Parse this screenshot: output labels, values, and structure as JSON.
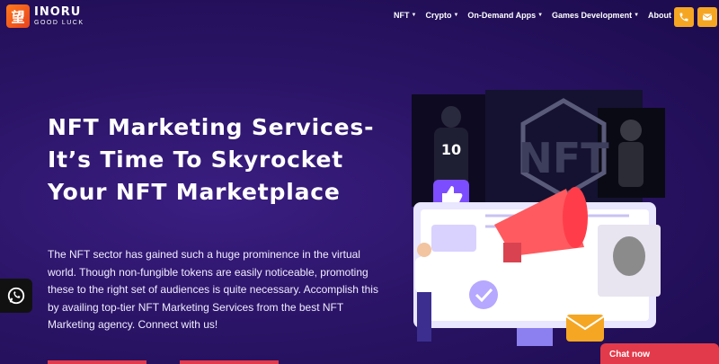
{
  "brand": {
    "logo_mark": "望",
    "name": "INORU",
    "tagline": "GOOD LUCK"
  },
  "nav": {
    "items": [
      {
        "label": "NFT",
        "has_dropdown": true
      },
      {
        "label": "Crypto",
        "has_dropdown": true
      },
      {
        "label": "On-Demand Apps",
        "has_dropdown": true
      },
      {
        "label": "Games Development",
        "has_dropdown": true
      },
      {
        "label": "About Us",
        "has_dropdown": false
      }
    ],
    "call_icon": "phone-icon",
    "mail_icon": "mail-icon"
  },
  "hero": {
    "title": "NFT Marketing Services- It’s Time To Skyrocket Your NFT Marketplace",
    "description": "The NFT sector has gained such a huge prominence in the virtual world. Though non-fungible tokens are easily noticeable, promoting these to the right set of audiences is quite necessary. Accomplish this by availing top-tier NFT Marketing Services from the best NFT Marketing agency. Connect with us!"
  },
  "illustration": {
    "jersey_number": "10",
    "badge_text": "NFT"
  },
  "chat": {
    "label": "Chat now"
  },
  "colors": {
    "accent_orange": "#f5a623",
    "accent_red": "#e23a4a",
    "bg_purple": "#2a1466"
  }
}
